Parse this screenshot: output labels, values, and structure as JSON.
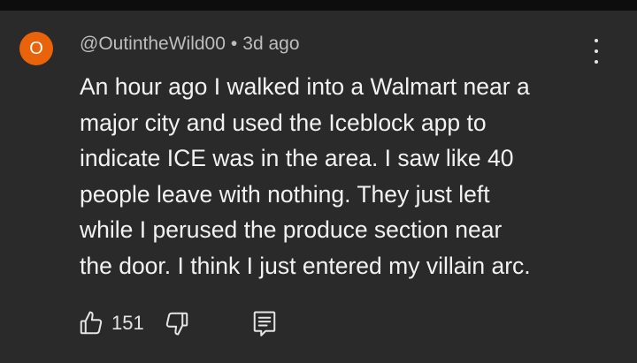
{
  "comment": {
    "avatar_letter": "O",
    "avatar_color": "#e8630a",
    "author": "@OutintheWild00",
    "separator": "•",
    "timestamp": "3d ago",
    "body_lines": [
      "An hour ago I walked into a Walmart near a",
      "major city and used the Iceblock app to",
      "indicate ICE was in the area. I saw like 40",
      "people leave with nothing. They just left",
      "while I perused the produce section near",
      "the door. I think I just entered my villain arc."
    ],
    "like_count": "151"
  },
  "icons": {
    "menu": "more-vertical-icon",
    "like": "thumbs-up-icon",
    "dislike": "thumbs-down-icon",
    "reply": "reply-icon"
  }
}
